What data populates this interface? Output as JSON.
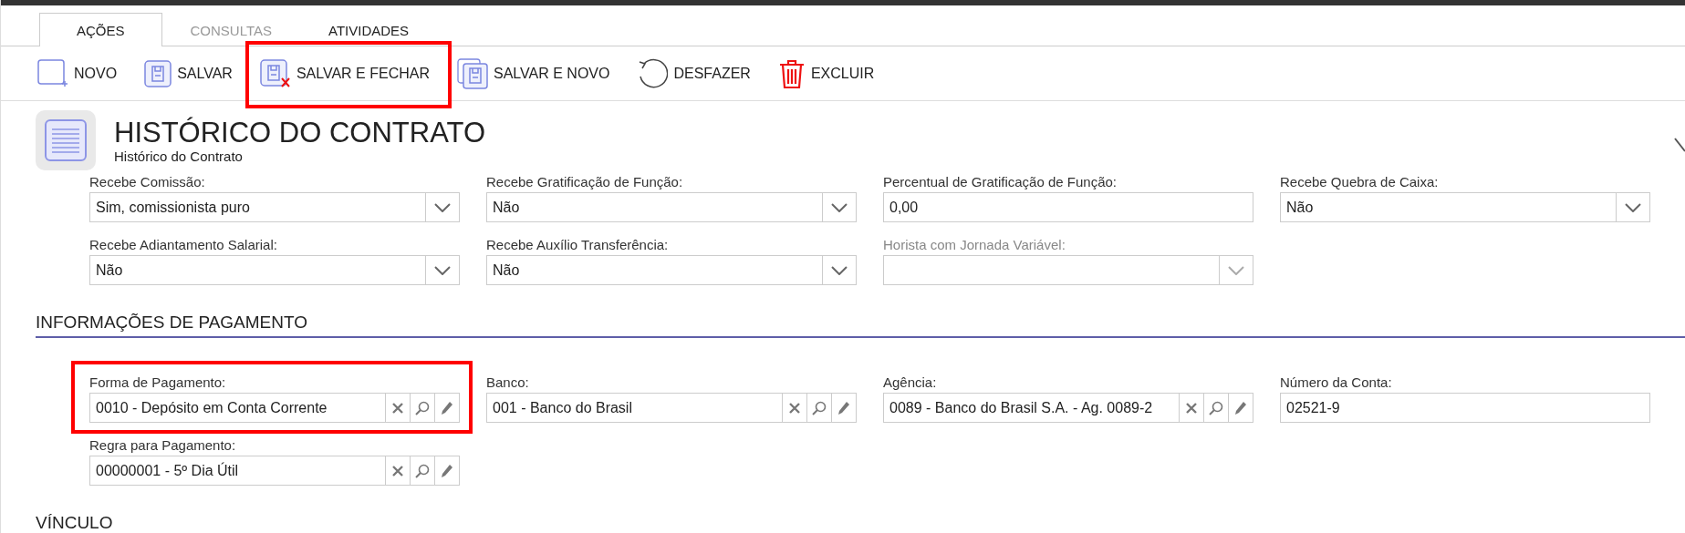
{
  "tabs": [
    {
      "label": "AÇÕES",
      "selected": true,
      "disabled": false
    },
    {
      "label": "CONSULTAS",
      "selected": false,
      "disabled": true
    },
    {
      "label": "ATIVIDADES",
      "selected": false,
      "disabled": false
    }
  ],
  "toolbar": [
    {
      "kind": "new",
      "label": "NOVO",
      "highlighted": false
    },
    {
      "kind": "save",
      "label": "SALVAR",
      "highlighted": false
    },
    {
      "kind": "save-close",
      "label": "SALVAR E FECHAR",
      "highlighted": true
    },
    {
      "kind": "save-new",
      "label": "SALVAR E NOVO",
      "highlighted": false
    },
    {
      "kind": "undo",
      "label": "DESFAZER",
      "highlighted": false
    },
    {
      "kind": "delete",
      "label": "EXCLUIR",
      "highlighted": false
    }
  ],
  "header": {
    "title": "HISTÓRICO DO CONTRATO",
    "subtitle": "Histórico do Contrato"
  },
  "fields": [
    {
      "kind": "select",
      "label": "Recebe Comissão:",
      "value": "Sim, comissionista puro",
      "disabled": false
    },
    {
      "kind": "select",
      "label": "Recebe Gratificação de Função:",
      "value": "Não",
      "disabled": false
    },
    {
      "kind": "text",
      "label": "Percentual de Gratificação de Função:",
      "value": "0,00",
      "disabled": false
    },
    {
      "kind": "select",
      "label": "Recebe Quebra de Caixa:",
      "value": "Não",
      "disabled": false
    },
    {
      "kind": "select",
      "label": "Recebe Adiantamento Salarial:",
      "value": "Não",
      "disabled": false
    },
    {
      "kind": "select",
      "label": "Recebe Auxílio Transferência:",
      "value": "Não",
      "disabled": false
    },
    {
      "kind": "select",
      "label": "Horista com Jornada Variável:",
      "disabled": true
    }
  ],
  "sections": [
    {
      "title": "INFORMAÇÕES DE PAGAMENTO",
      "fields": [
        {
          "kind": "lookup",
          "label": "Forma de Pagamento:",
          "value": "0010 - Depósito em Conta Corrente",
          "highlighted": true
        },
        {
          "kind": "lookup",
          "label": "Banco:",
          "value": "001 - Banco do Brasil",
          "highlighted": false
        },
        {
          "kind": "lookup",
          "label": "Agência:",
          "value": "0089 - Banco do Brasil S.A. - Ag. 0089-2",
          "highlighted": false
        },
        {
          "kind": "text",
          "label": "Número da Conta:",
          "value": "02521-9",
          "highlighted": false
        },
        {
          "kind": "lookup",
          "label": "Regra para Pagamento:",
          "value": "00000001 - 5º Dia Útil",
          "highlighted": false
        }
      ]
    },
    {
      "title": "VÍNCULO"
    }
  ]
}
